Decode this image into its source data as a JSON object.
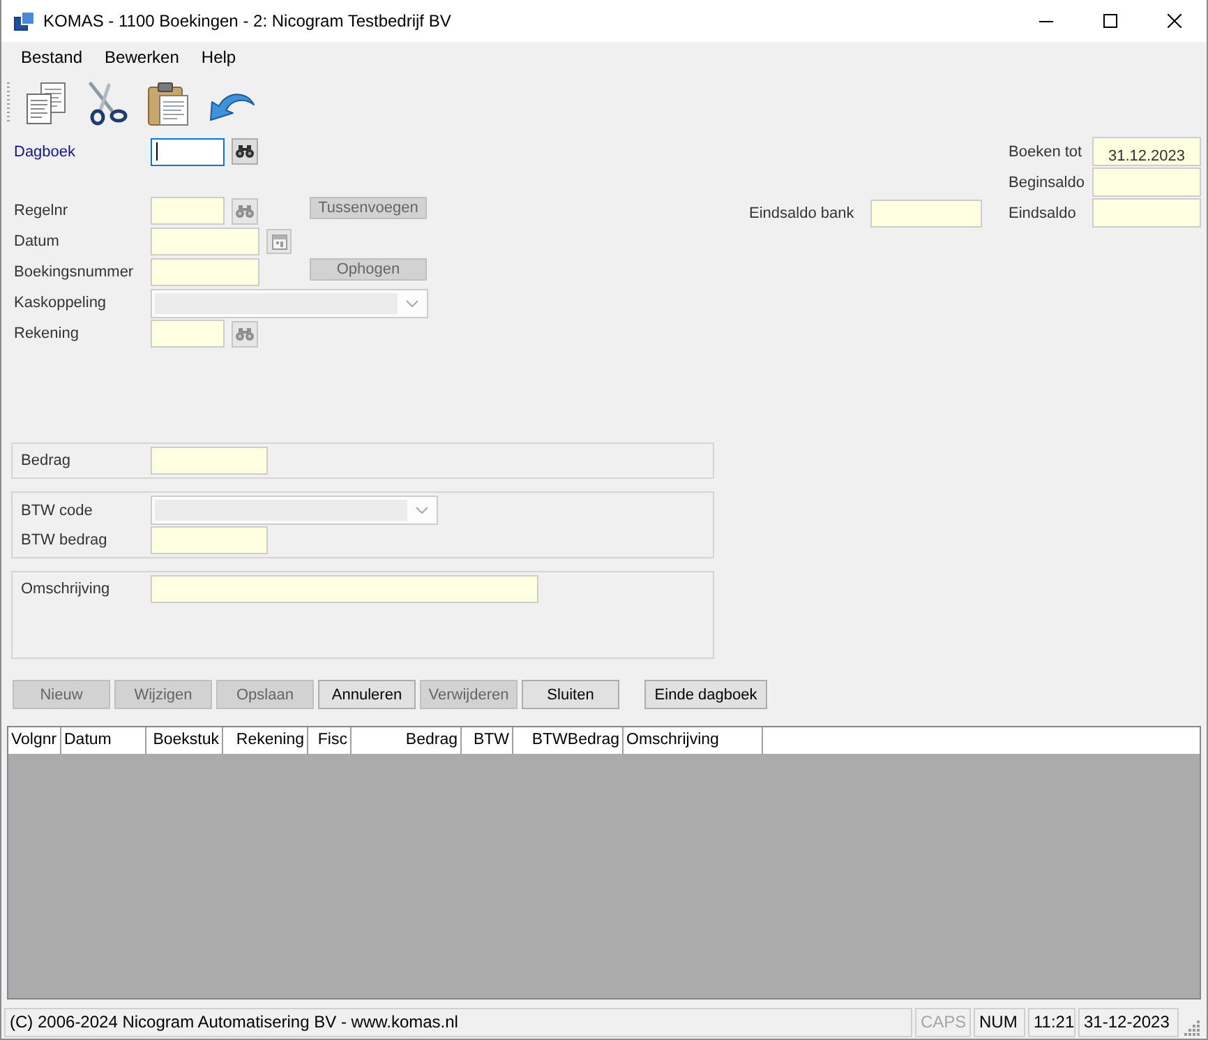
{
  "window": {
    "title": "KOMAS - 1100 Boekingen - 2: Nicogram Testbedrijf BV"
  },
  "menu": [
    {
      "label": "Bestand"
    },
    {
      "label": "Bewerken"
    },
    {
      "label": "Help"
    }
  ],
  "journal": {
    "label": "Dagboek",
    "focused": true,
    "side_button": {
      "disabled": false
    }
  },
  "entry": [
    {
      "kind": "lookup",
      "label": "Regelnr",
      "side_button": {
        "disabled": true
      },
      "action": {
        "label": "Tussenvoegen",
        "disabled": true
      }
    },
    {
      "kind": "date",
      "label": "Datum",
      "side_button": {
        "disabled": true
      }
    },
    {
      "kind": "number",
      "label": "Boekingsnummer",
      "action": {
        "label": "Ophogen",
        "disabled": true
      }
    },
    {
      "kind": "combo",
      "label": "Kaskoppeling",
      "disabled": true
    },
    {
      "kind": "lookup",
      "label": "Rekening",
      "side_button": {
        "disabled": true
      }
    }
  ],
  "bank_balance": {
    "label": "Eindsaldo bank"
  },
  "balances": [
    {
      "label": "Boeken tot",
      "value": "31.12.2023"
    },
    {
      "label": "Beginsaldo"
    },
    {
      "label": "Eindsaldo"
    }
  ],
  "groups": [
    {
      "fields": [
        {
          "kind": "amount",
          "label": "Bedrag"
        }
      ]
    },
    {
      "fields": [
        {
          "kind": "combo",
          "label": "BTW code",
          "disabled": true
        },
        {
          "kind": "amount",
          "label": "BTW bedrag"
        }
      ]
    },
    {
      "fields": [
        {
          "kind": "memo",
          "label": "Omschrijving"
        }
      ]
    }
  ],
  "buttons": [
    {
      "label": "Nieuw",
      "disabled": true
    },
    {
      "label": "Wijzigen",
      "disabled": true
    },
    {
      "label": "Opslaan",
      "disabled": true
    },
    {
      "label": "Annuleren",
      "disabled": false
    },
    {
      "label": "Verwijderen",
      "disabled": true
    },
    {
      "label": "Sluiten",
      "disabled": false
    }
  ],
  "end_button": {
    "label": "Einde dagboek",
    "disabled": false
  },
  "table": {
    "columns": [
      {
        "label": "Volgnr",
        "kind": "text"
      },
      {
        "label": "Datum",
        "kind": "text"
      },
      {
        "label": "Boekstuk",
        "kind": "number"
      },
      {
        "label": "Rekening",
        "kind": "number"
      },
      {
        "label": "Fisc",
        "kind": "number"
      },
      {
        "label": "Bedrag",
        "kind": "number"
      },
      {
        "label": "BTW",
        "kind": "number"
      },
      {
        "label": "BTWBedrag",
        "kind": "number"
      },
      {
        "label": "Omschrijving",
        "kind": "text"
      }
    ]
  },
  "status_bar": {
    "text": "(C) 2006-2024 Nicogram Automatisering BV - www.komas.nl",
    "indicators": [
      {
        "label": "CAPS",
        "on": false
      },
      {
        "label": "NUM",
        "on": true
      }
    ],
    "time": "11:21",
    "date": "31-12-2023"
  }
}
